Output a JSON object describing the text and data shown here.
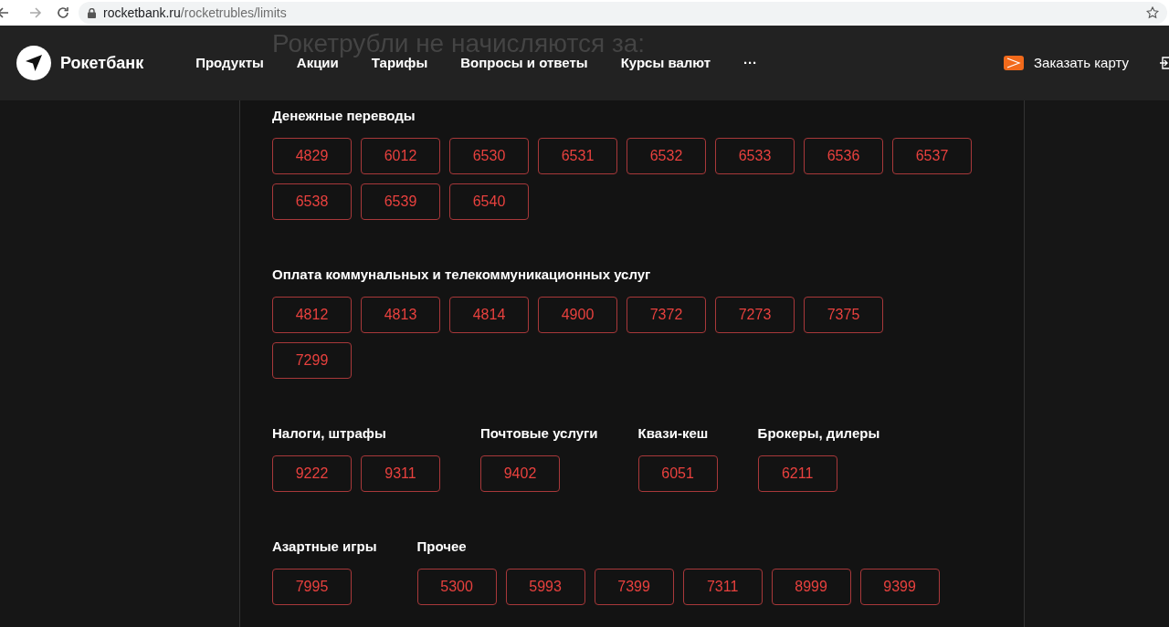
{
  "browser": {
    "url_host": "rocketbank.ru",
    "url_path": "/rocketrubles/limits"
  },
  "header": {
    "logo": "Рокетбанк",
    "nav": [
      "Продукты",
      "Акции",
      "Тарифы",
      "Вопросы и ответы",
      "Курсы валют",
      "···"
    ],
    "order_card": "Заказать карту"
  },
  "page_title": "Рокетрубли не начисляются за:",
  "rows": [
    [
      {
        "title": "Денежные переводы",
        "code_lines": [
          [
            "4829",
            "6012",
            "6530",
            "6531",
            "6532",
            "6533",
            "6536",
            "6537"
          ],
          [
            "6538",
            "6539",
            "6540"
          ]
        ]
      }
    ],
    [
      {
        "title": "Оплата коммунальных и телекоммуникационных услуг",
        "code_lines": [
          [
            "4812",
            "4813",
            "4814",
            "4900",
            "7372",
            "7273",
            "7375"
          ],
          [
            "7299"
          ]
        ]
      }
    ],
    [
      {
        "title": "Налоги, штрафы",
        "code_lines": [
          [
            "9222",
            "9311"
          ]
        ]
      },
      {
        "title": "Почтовые услуги",
        "code_lines": [
          [
            "9402"
          ]
        ]
      },
      {
        "title": "Квази-кеш",
        "code_lines": [
          [
            "6051"
          ]
        ]
      },
      {
        "title": "Брокеры, дилеры",
        "code_lines": [
          [
            "6211"
          ]
        ]
      }
    ],
    [
      {
        "title": "Азартные игры",
        "code_lines": [
          [
            "7995"
          ]
        ]
      },
      {
        "title": "Прочее",
        "code_lines": [
          [
            "5300",
            "5993",
            "7399",
            "7311",
            "8999",
            "9399"
          ]
        ]
      }
    ]
  ]
}
